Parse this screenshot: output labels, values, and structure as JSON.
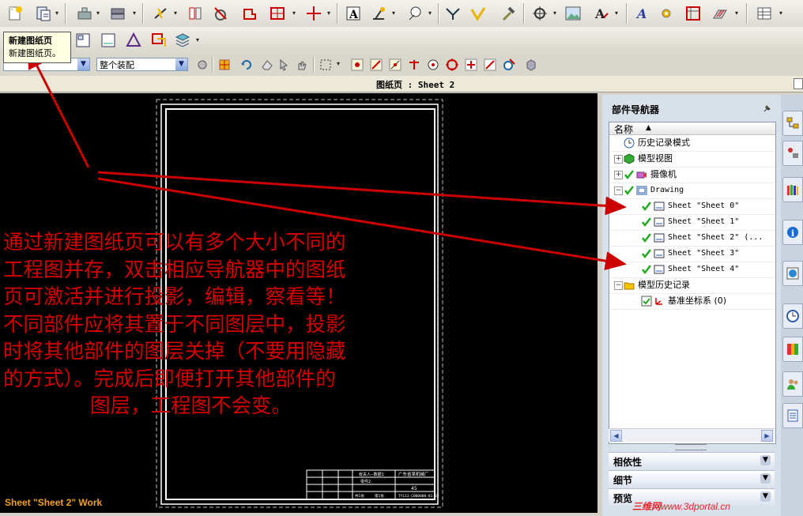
{
  "tooltip": {
    "title": "新建图纸页",
    "desc": "新建图纸页。"
  },
  "toolbar2": {
    "filter_value": "",
    "assembly_value": "整个装配"
  },
  "title_bar": {
    "text": "图纸页 : Sheet 2"
  },
  "annotation": {
    "lines": [
      "通过新建图纸页可以有多个大小不同的",
      "工程图并存，双击相应导航器中的图纸",
      "页可激活并进行投影，编辑，察看等！",
      "不同部件应将其置于不同图层中，投影",
      "时将其他部件的图层关掉（不要用隐藏",
      "的方式）。完成后即便打开其他部件的",
      "图层，工程图不会变。"
    ]
  },
  "sheet_label": "Sheet \"Sheet 2\" Work",
  "title_block": {
    "company": "广东省某机械厂",
    "drawing_no": "TY112-C000000-01-02",
    "scale": "45",
    "name": "零件2",
    "cells": [
      "有关人--数据1",
      "共1张",
      "第1张"
    ]
  },
  "navigator": {
    "title": "部件导航器",
    "column_header": "名称",
    "items": [
      {
        "label": "历史记录模式",
        "icon": "clock-icon",
        "indent": 0,
        "expander": "",
        "check": false
      },
      {
        "label": "模型视图",
        "icon": "model-views-icon",
        "indent": 0,
        "expander": "+",
        "check": false
      },
      {
        "label": "摄像机",
        "icon": "camera-icon",
        "indent": 0,
        "expander": "+",
        "check": true
      },
      {
        "label": "Drawing",
        "icon": "drawing-icon",
        "indent": 0,
        "expander": "-",
        "check": true
      },
      {
        "label": "Sheet \"Sheet 0\"",
        "icon": "sheet-icon",
        "indent": 1,
        "expander": "",
        "check": true
      },
      {
        "label": "Sheet \"Sheet 1\"",
        "icon": "sheet-icon",
        "indent": 1,
        "expander": "",
        "check": true
      },
      {
        "label": "Sheet \"Sheet 2\" (...",
        "icon": "sheet-icon",
        "indent": 1,
        "expander": "",
        "check": true
      },
      {
        "label": "Sheet \"Sheet 3\"",
        "icon": "sheet-icon",
        "indent": 1,
        "expander": "",
        "check": true
      },
      {
        "label": "Sheet \"Sheet 4\"",
        "icon": "sheet-icon",
        "indent": 1,
        "expander": "",
        "check": true
      },
      {
        "label": "模型历史记录",
        "icon": "folder-icon",
        "indent": 0,
        "expander": "-",
        "check": false
      },
      {
        "label": "基准坐标系 (0)",
        "icon": "datum-csys-icon",
        "indent": 1,
        "expander": "",
        "check": true
      }
    ],
    "sections": [
      "相依性",
      "细节",
      "预览"
    ]
  },
  "watermark": {
    "cn": "三维网",
    "url": "www.3dportal.cn"
  },
  "colors": {
    "annotation": "#d40000",
    "sheet_label": "#f0a020",
    "arrow": "#cc0000",
    "check": "#22aa22"
  }
}
